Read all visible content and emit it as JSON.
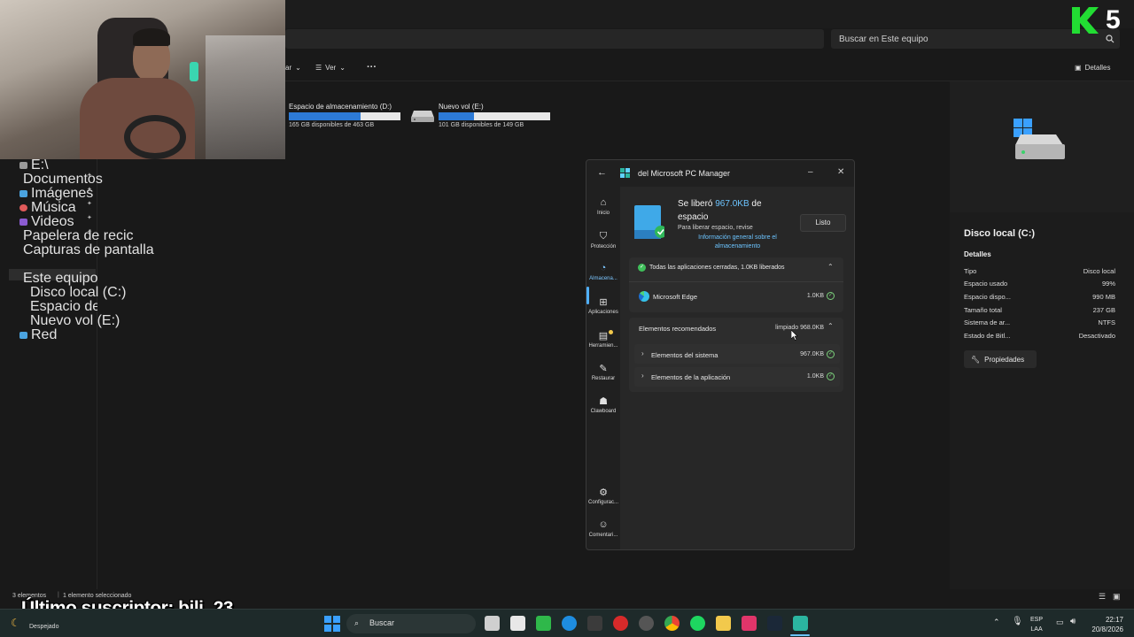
{
  "explorer": {
    "search_placeholder": "Buscar en Este equipo",
    "cmd_sort_fragment": "ar",
    "cmd_view": "Ver",
    "cmd_more": "···",
    "details_toggle": "Detalles",
    "drives": [
      {
        "name": "Espacio de almacenamiento (D:)",
        "free_text": "165 GB disponibles de 463 GB",
        "used_fraction": 0.64
      },
      {
        "name": "Nuevo vol (E:)",
        "free_text": "101 GB disponibles de 149 GB",
        "used_fraction": 0.32
      }
    ],
    "nav_items": [
      {
        "label": "E:\\",
        "pinned": false
      },
      {
        "label": "Documentos",
        "pinned": true
      },
      {
        "label": "Imágenes",
        "pinned": true
      },
      {
        "label": "Música",
        "pinned": true
      },
      {
        "label": "Videos",
        "pinned": true
      },
      {
        "label": "Papelera de recic",
        "pinned": true
      },
      {
        "label": "Capturas de pantalla",
        "pinned": false
      },
      {
        "label": "Este equipo",
        "pinned": false
      },
      {
        "label": "Disco local (C:)",
        "pinned": false
      },
      {
        "label": "Espacio de almace",
        "pinned": false
      },
      {
        "label": "Nuevo vol (E:)",
        "pinned": false
      },
      {
        "label": "Red",
        "pinned": false
      }
    ],
    "status_items": "3 elementos",
    "status_selected": "1 elemento seleccionado"
  },
  "details": {
    "title": "Disco local (C:)",
    "section": "Detalles",
    "rows": [
      {
        "label": "Tipo",
        "value": "Disco local"
      },
      {
        "label": "Espacio usado",
        "value": "99%"
      },
      {
        "label": "Espacio dispo...",
        "value": "990 MB"
      },
      {
        "label": "Tamaño total",
        "value": "237 GB"
      },
      {
        "label": "Sistema de ar...",
        "value": "NTFS"
      },
      {
        "label": "Estado de Bitl...",
        "value": "Desactivado"
      }
    ],
    "properties_button": "Propiedades"
  },
  "pcm": {
    "title": "del Microsoft PC Manager",
    "freed_prefix": "Se liberó ",
    "freed_amount": "967.0KB",
    "freed_suffix": " de",
    "freed_line2": "espacio",
    "hint": "Para liberar espacio, revise",
    "link": "Información general sobre el almacenamiento",
    "done_button": "Listo",
    "side": [
      {
        "label": "Inicio",
        "glyph": "⌂"
      },
      {
        "label": "Protección",
        "glyph": "⛉"
      },
      {
        "label": "Almacena...",
        "glyph": "◔"
      },
      {
        "label": "Aplicaciones",
        "glyph": "⊞"
      },
      {
        "label": "Herramien...",
        "glyph": "▤"
      },
      {
        "label": "Restaurar",
        "glyph": "✎"
      },
      {
        "label": "Clawboard",
        "glyph": "☗"
      },
      {
        "label": "Configurac...",
        "glyph": "⚙"
      },
      {
        "label": "Comentari...",
        "glyph": "☺"
      }
    ],
    "apps_closed": "Todas las aplicaciones cerradas, 1.0KB liberados",
    "edge_label": "Microsoft Edge",
    "edge_value": "1.0KB",
    "recommended": "Elementos recomendados",
    "recommended_value": "limpiado 968.0KB",
    "system_items": "Elementos del sistema",
    "system_value": "967.0KB",
    "app_items": "Elementos de la aplicación",
    "app_value": "1.0KB"
  },
  "overlay": "Último suscriptor: bili_23",
  "taskbar": {
    "search": "Buscar",
    "weather": "Despejado",
    "lang1": "ESP",
    "lang2": "LAA",
    "time": "22:17",
    "date": "20/8/2026"
  },
  "logo_digit": "5",
  "colors": {
    "accent": "#2d7ad6",
    "link": "#6cc4ff",
    "success": "#7bd07b",
    "logo_green": "#22dd33"
  }
}
